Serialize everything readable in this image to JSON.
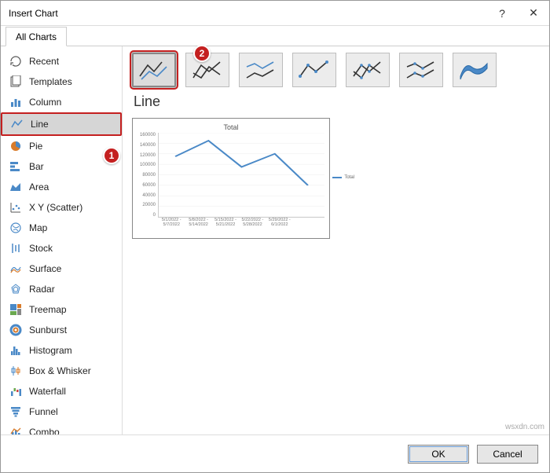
{
  "title": "Insert Chart",
  "titlebar_help": "?",
  "titlebar_close": "✕",
  "tab_label": "All Charts",
  "categories": [
    {
      "id": "recent",
      "label": "Recent"
    },
    {
      "id": "templates",
      "label": "Templates"
    },
    {
      "id": "column",
      "label": "Column"
    },
    {
      "id": "line",
      "label": "Line",
      "selected": true
    },
    {
      "id": "pie",
      "label": "Pie"
    },
    {
      "id": "bar",
      "label": "Bar"
    },
    {
      "id": "area",
      "label": "Area"
    },
    {
      "id": "xy",
      "label": "X Y (Scatter)"
    },
    {
      "id": "map",
      "label": "Map"
    },
    {
      "id": "stock",
      "label": "Stock"
    },
    {
      "id": "surface",
      "label": "Surface"
    },
    {
      "id": "radar",
      "label": "Radar"
    },
    {
      "id": "treemap",
      "label": "Treemap"
    },
    {
      "id": "sunburst",
      "label": "Sunburst"
    },
    {
      "id": "histogram",
      "label": "Histogram"
    },
    {
      "id": "box",
      "label": "Box & Whisker"
    },
    {
      "id": "waterfall",
      "label": "Waterfall"
    },
    {
      "id": "funnel",
      "label": "Funnel"
    },
    {
      "id": "combo",
      "label": "Combo"
    }
  ],
  "subtype_count": 7,
  "subtype_selected_index": 0,
  "heading": "Line",
  "preview": {
    "title": "Total",
    "legend_label": "Total"
  },
  "buttons": {
    "ok": "OK",
    "cancel": "Cancel"
  },
  "annotations": {
    "badge1": "1",
    "badge2": "2"
  },
  "watermark": "wsxdn.com",
  "chart_data": {
    "type": "line",
    "title": "Total",
    "ylabel": "",
    "xlabel": "",
    "ylim": [
      0,
      160000
    ],
    "yticks": [
      0,
      20000,
      40000,
      60000,
      80000,
      100000,
      120000,
      140000,
      160000
    ],
    "categories": [
      "5/1/2022 - 5/7/2022",
      "5/8/2022 - 5/14/2022",
      "5/15/2022 - 5/21/2022",
      "5/22/2022 - 5/28/2022",
      "5/29/2022 - 6/1/2022"
    ],
    "series": [
      {
        "name": "Total",
        "values": [
          115000,
          145000,
          95000,
          120000,
          60000
        ]
      }
    ]
  }
}
